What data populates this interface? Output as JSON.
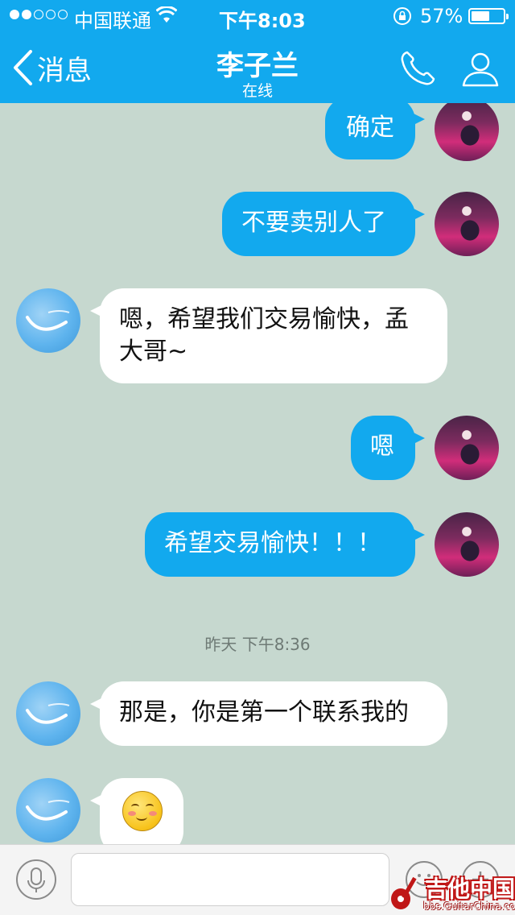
{
  "status_bar": {
    "carrier": "中国联通",
    "time": "下午8:03",
    "battery_percent": "57%",
    "battery_level": 0.57,
    "signal_bars": 2,
    "icons": [
      "signal-dots-icon",
      "wifi-icon",
      "rotation-lock-icon",
      "battery-icon"
    ]
  },
  "nav": {
    "back_label": "消息",
    "title": "李子兰",
    "subtitle": "在线",
    "icons": [
      "back-chevron-icon",
      "phone-icon",
      "profile-icon"
    ]
  },
  "messages": [
    {
      "from": "me",
      "text": "确定"
    },
    {
      "from": "me",
      "text": "不要卖别人了"
    },
    {
      "from": "them",
      "text": "嗯，希望我们交易愉快，孟大哥~"
    },
    {
      "from": "me",
      "text": "嗯"
    },
    {
      "from": "me",
      "text": "希望交易愉快！！！"
    },
    {
      "from": "them",
      "text": "那是，你是第一个联系我的"
    },
    {
      "from": "them",
      "emoji": "smiling-blush-emoji"
    }
  ],
  "timestamp": "昨天 下午8:36",
  "input_bar": {
    "text_value": "",
    "icons": [
      "microphone-icon",
      "emoji-icon",
      "plus-icon"
    ]
  },
  "watermark": {
    "main": "吉他中国",
    "url": "bbs.GuitarChina.com"
  },
  "colors": {
    "accent": "#12a9ee",
    "chat_background": "#c6d8cf",
    "their_bubble": "#ffffff"
  }
}
